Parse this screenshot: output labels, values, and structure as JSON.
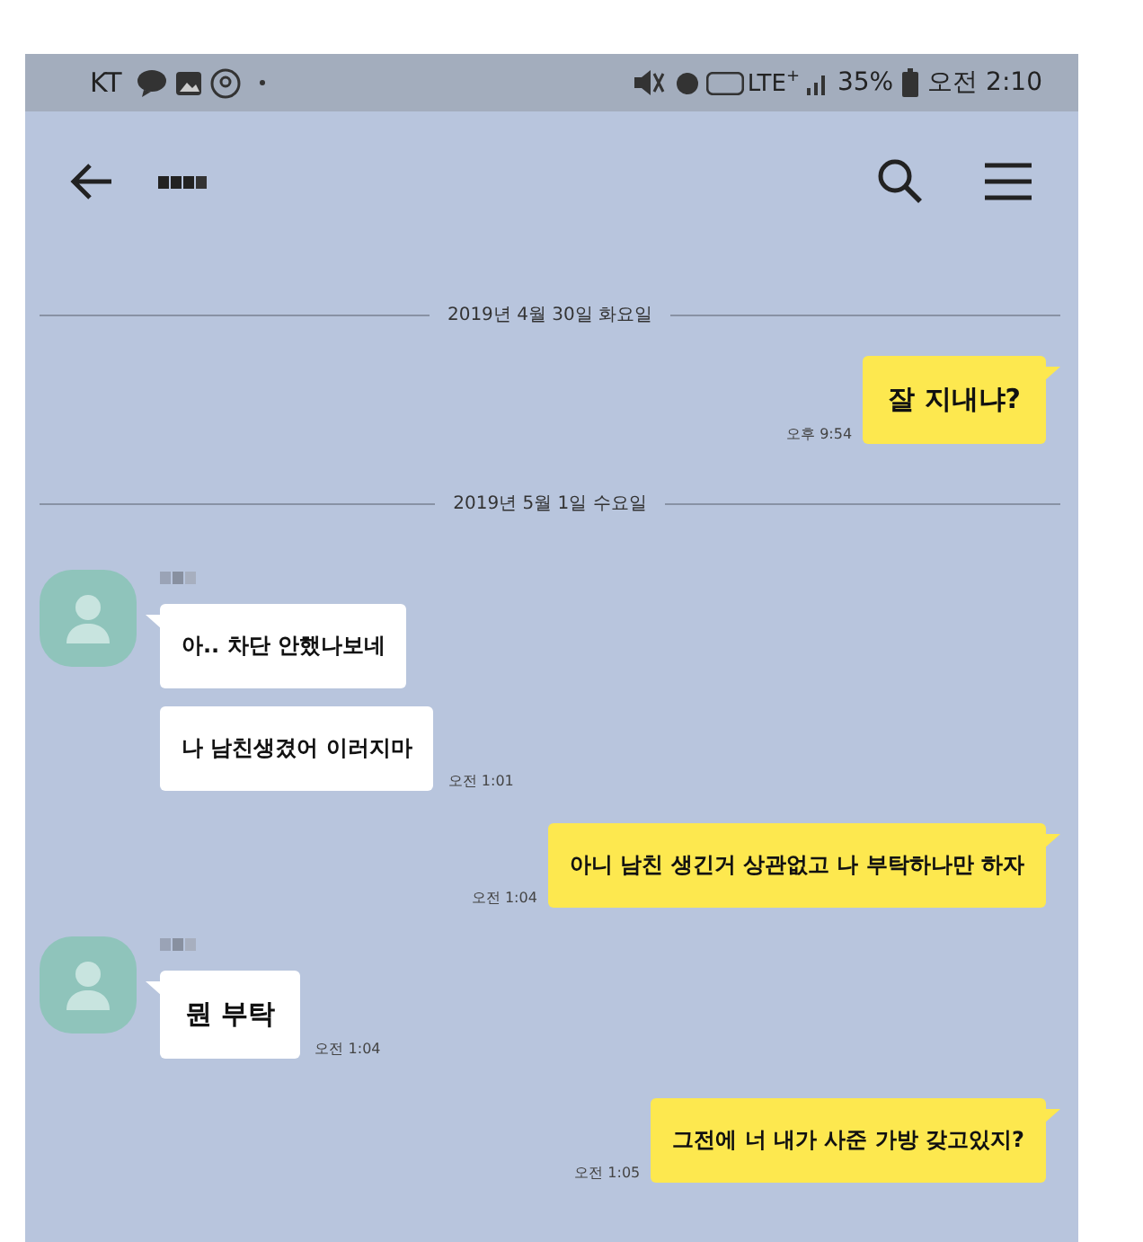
{
  "status_bar": {
    "carrier": "KT",
    "network": "LTE",
    "network_plus": "+",
    "battery": "35%",
    "time": "오전 2:10"
  },
  "chat": [
    {
      "kind": "date",
      "text": "2019년 4월 30일 화요일"
    },
    {
      "kind": "sent",
      "messages": [
        "잘 지내냐?"
      ],
      "time": "오후 9:54"
    },
    {
      "kind": "date",
      "text": "2019년 5월 1일 수요일"
    },
    {
      "kind": "received",
      "messages": [
        "아.. 차단 안했나보네",
        "나 남친생겼어 이러지마"
      ],
      "time": "오전 1:01"
    },
    {
      "kind": "sent",
      "messages": [
        "아니 남친 생긴거 상관없고 나 부탁하나만 하자"
      ],
      "time": "오전 1:04"
    },
    {
      "kind": "received",
      "messages": [
        "뭔 부탁"
      ],
      "time": "오전 1:04"
    },
    {
      "kind": "sent",
      "messages": [
        "그전에 너 내가 사준 가방 갖고있지?"
      ],
      "time": "오전 1:05"
    }
  ]
}
